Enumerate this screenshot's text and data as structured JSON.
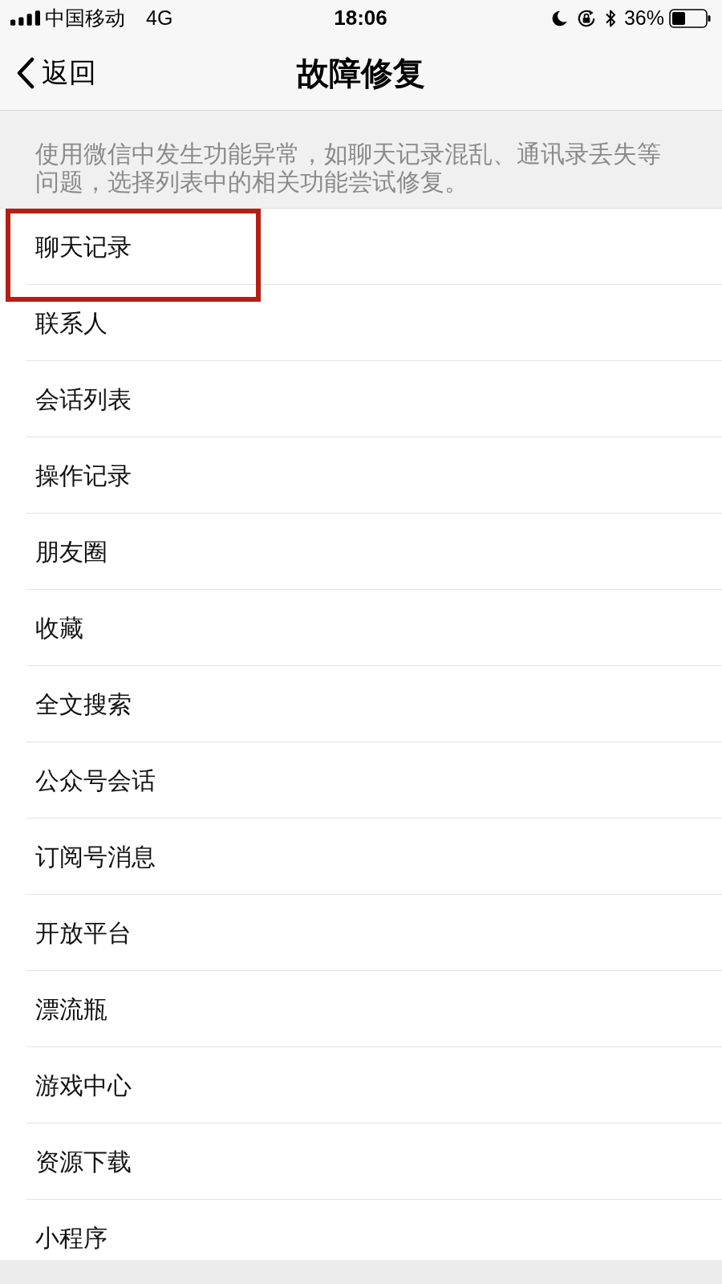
{
  "status_bar": {
    "carrier": "中国移动",
    "network": "4G",
    "time": "18:06",
    "battery": "36%"
  },
  "nav_bar": {
    "back": "返回",
    "title": "故障修复"
  },
  "description": "使用微信中发生功能异常，如聊天记录混乱、通讯录丢失等问题，选择列表中的相关功能尝试修复。",
  "items": [
    {
      "label": "聊天记录",
      "highlighted": true
    },
    {
      "label": "联系人",
      "highlighted": false
    },
    {
      "label": "会话列表",
      "highlighted": false
    },
    {
      "label": "操作记录",
      "highlighted": false
    },
    {
      "label": "朋友圈",
      "highlighted": false
    },
    {
      "label": "收藏",
      "highlighted": false
    },
    {
      "label": "全文搜索",
      "highlighted": false
    },
    {
      "label": "公众号会话",
      "highlighted": false
    },
    {
      "label": "订阅号消息",
      "highlighted": false
    },
    {
      "label": "开放平台",
      "highlighted": false
    },
    {
      "label": "漂流瓶",
      "highlighted": false
    },
    {
      "label": "游戏中心",
      "highlighted": false
    },
    {
      "label": "资源下载",
      "highlighted": false
    },
    {
      "label": "小程序",
      "highlighted": false
    }
  ]
}
